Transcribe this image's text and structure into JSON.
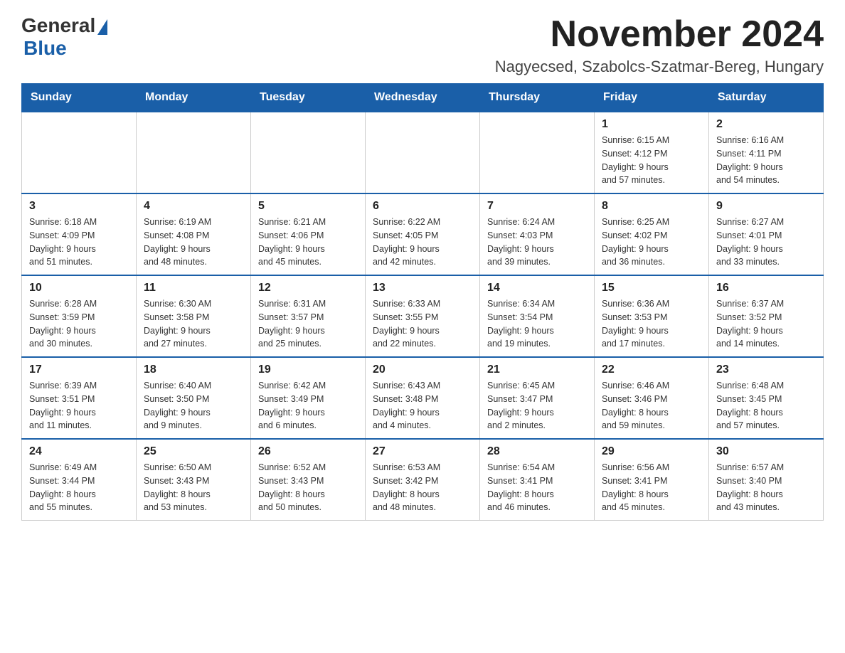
{
  "logo": {
    "general": "General",
    "blue": "Blue"
  },
  "title": "November 2024",
  "location": "Nagyecsed, Szabolcs-Szatmar-Bereg, Hungary",
  "weekdays": [
    "Sunday",
    "Monday",
    "Tuesday",
    "Wednesday",
    "Thursday",
    "Friday",
    "Saturday"
  ],
  "weeks": [
    [
      {
        "day": "",
        "info": ""
      },
      {
        "day": "",
        "info": ""
      },
      {
        "day": "",
        "info": ""
      },
      {
        "day": "",
        "info": ""
      },
      {
        "day": "",
        "info": ""
      },
      {
        "day": "1",
        "info": "Sunrise: 6:15 AM\nSunset: 4:12 PM\nDaylight: 9 hours\nand 57 minutes."
      },
      {
        "day": "2",
        "info": "Sunrise: 6:16 AM\nSunset: 4:11 PM\nDaylight: 9 hours\nand 54 minutes."
      }
    ],
    [
      {
        "day": "3",
        "info": "Sunrise: 6:18 AM\nSunset: 4:09 PM\nDaylight: 9 hours\nand 51 minutes."
      },
      {
        "day": "4",
        "info": "Sunrise: 6:19 AM\nSunset: 4:08 PM\nDaylight: 9 hours\nand 48 minutes."
      },
      {
        "day": "5",
        "info": "Sunrise: 6:21 AM\nSunset: 4:06 PM\nDaylight: 9 hours\nand 45 minutes."
      },
      {
        "day": "6",
        "info": "Sunrise: 6:22 AM\nSunset: 4:05 PM\nDaylight: 9 hours\nand 42 minutes."
      },
      {
        "day": "7",
        "info": "Sunrise: 6:24 AM\nSunset: 4:03 PM\nDaylight: 9 hours\nand 39 minutes."
      },
      {
        "day": "8",
        "info": "Sunrise: 6:25 AM\nSunset: 4:02 PM\nDaylight: 9 hours\nand 36 minutes."
      },
      {
        "day": "9",
        "info": "Sunrise: 6:27 AM\nSunset: 4:01 PM\nDaylight: 9 hours\nand 33 minutes."
      }
    ],
    [
      {
        "day": "10",
        "info": "Sunrise: 6:28 AM\nSunset: 3:59 PM\nDaylight: 9 hours\nand 30 minutes."
      },
      {
        "day": "11",
        "info": "Sunrise: 6:30 AM\nSunset: 3:58 PM\nDaylight: 9 hours\nand 27 minutes."
      },
      {
        "day": "12",
        "info": "Sunrise: 6:31 AM\nSunset: 3:57 PM\nDaylight: 9 hours\nand 25 minutes."
      },
      {
        "day": "13",
        "info": "Sunrise: 6:33 AM\nSunset: 3:55 PM\nDaylight: 9 hours\nand 22 minutes."
      },
      {
        "day": "14",
        "info": "Sunrise: 6:34 AM\nSunset: 3:54 PM\nDaylight: 9 hours\nand 19 minutes."
      },
      {
        "day": "15",
        "info": "Sunrise: 6:36 AM\nSunset: 3:53 PM\nDaylight: 9 hours\nand 17 minutes."
      },
      {
        "day": "16",
        "info": "Sunrise: 6:37 AM\nSunset: 3:52 PM\nDaylight: 9 hours\nand 14 minutes."
      }
    ],
    [
      {
        "day": "17",
        "info": "Sunrise: 6:39 AM\nSunset: 3:51 PM\nDaylight: 9 hours\nand 11 minutes."
      },
      {
        "day": "18",
        "info": "Sunrise: 6:40 AM\nSunset: 3:50 PM\nDaylight: 9 hours\nand 9 minutes."
      },
      {
        "day": "19",
        "info": "Sunrise: 6:42 AM\nSunset: 3:49 PM\nDaylight: 9 hours\nand 6 minutes."
      },
      {
        "day": "20",
        "info": "Sunrise: 6:43 AM\nSunset: 3:48 PM\nDaylight: 9 hours\nand 4 minutes."
      },
      {
        "day": "21",
        "info": "Sunrise: 6:45 AM\nSunset: 3:47 PM\nDaylight: 9 hours\nand 2 minutes."
      },
      {
        "day": "22",
        "info": "Sunrise: 6:46 AM\nSunset: 3:46 PM\nDaylight: 8 hours\nand 59 minutes."
      },
      {
        "day": "23",
        "info": "Sunrise: 6:48 AM\nSunset: 3:45 PM\nDaylight: 8 hours\nand 57 minutes."
      }
    ],
    [
      {
        "day": "24",
        "info": "Sunrise: 6:49 AM\nSunset: 3:44 PM\nDaylight: 8 hours\nand 55 minutes."
      },
      {
        "day": "25",
        "info": "Sunrise: 6:50 AM\nSunset: 3:43 PM\nDaylight: 8 hours\nand 53 minutes."
      },
      {
        "day": "26",
        "info": "Sunrise: 6:52 AM\nSunset: 3:43 PM\nDaylight: 8 hours\nand 50 minutes."
      },
      {
        "day": "27",
        "info": "Sunrise: 6:53 AM\nSunset: 3:42 PM\nDaylight: 8 hours\nand 48 minutes."
      },
      {
        "day": "28",
        "info": "Sunrise: 6:54 AM\nSunset: 3:41 PM\nDaylight: 8 hours\nand 46 minutes."
      },
      {
        "day": "29",
        "info": "Sunrise: 6:56 AM\nSunset: 3:41 PM\nDaylight: 8 hours\nand 45 minutes."
      },
      {
        "day": "30",
        "info": "Sunrise: 6:57 AM\nSunset: 3:40 PM\nDaylight: 8 hours\nand 43 minutes."
      }
    ]
  ]
}
